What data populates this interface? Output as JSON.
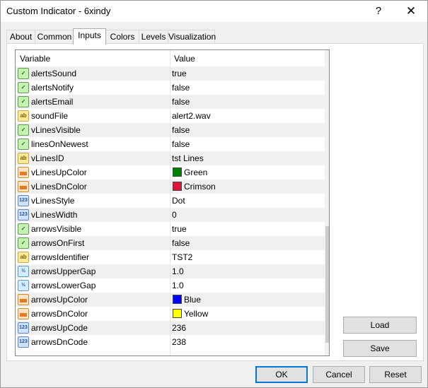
{
  "window": {
    "title": "Custom Indicator - 6xindy",
    "help_label": "?",
    "close_label": "✕"
  },
  "tabs": [
    {
      "label": "About"
    },
    {
      "label": "Common"
    },
    {
      "label": "Inputs"
    },
    {
      "label": "Colors"
    },
    {
      "label": "Levels"
    },
    {
      "label": "Visualization"
    }
  ],
  "active_tab": "Inputs",
  "grid": {
    "columns": {
      "variable": "Variable",
      "value": "Value"
    },
    "rows": [
      {
        "icon": "bool-icon",
        "name": "alertsSound",
        "value": "true"
      },
      {
        "icon": "bool-icon",
        "name": "alertsNotify",
        "value": "false"
      },
      {
        "icon": "bool-icon",
        "name": "alertsEmail",
        "value": "false"
      },
      {
        "icon": "string-icon",
        "name": "soundFile",
        "value": "alert2.wav"
      },
      {
        "icon": "bool-icon",
        "name": "vLinesVisible",
        "value": "false"
      },
      {
        "icon": "bool-icon",
        "name": "linesOnNewest",
        "value": "false"
      },
      {
        "icon": "string-icon",
        "name": "vLinesID",
        "value": "tst Lines"
      },
      {
        "icon": "color-icon",
        "name": "vLinesUpColor",
        "value": "Green",
        "color": "#008000"
      },
      {
        "icon": "color-icon",
        "name": "vLinesDnColor",
        "value": "Crimson",
        "color": "#dc143c"
      },
      {
        "icon": "int-icon",
        "name": "vLinesStyle",
        "value": "Dot"
      },
      {
        "icon": "int-icon",
        "name": "vLinesWidth",
        "value": "0"
      },
      {
        "icon": "bool-icon",
        "name": "arrowsVisible",
        "value": "true"
      },
      {
        "icon": "bool-icon",
        "name": "arrowsOnFirst",
        "value": "false"
      },
      {
        "icon": "string-icon",
        "name": "arrowsIdentifier",
        "value": "TST2"
      },
      {
        "icon": "double-icon",
        "name": "arrowsUpperGap",
        "value": "1.0"
      },
      {
        "icon": "double-icon",
        "name": "arrowsLowerGap",
        "value": "1.0"
      },
      {
        "icon": "color-icon",
        "name": "arrowsUpColor",
        "value": "Blue",
        "color": "#0000ff"
      },
      {
        "icon": "color-icon",
        "name": "arrowsDnColor",
        "value": "Yellow",
        "color": "#ffff00"
      },
      {
        "icon": "int-icon",
        "name": "arrowsUpCode",
        "value": "236"
      },
      {
        "icon": "int-icon",
        "name": "arrowsDnCode",
        "value": "238"
      }
    ]
  },
  "side_buttons": {
    "load": "Load",
    "save": "Save"
  },
  "footer": {
    "ok": "OK",
    "cancel": "Cancel",
    "reset": "Reset"
  }
}
